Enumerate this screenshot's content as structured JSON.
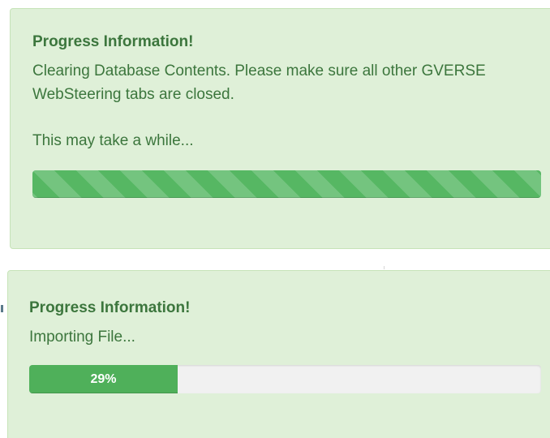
{
  "alerts": [
    {
      "title": "Progress Information!",
      "message": "Clearing Database Contents. Please make sure all other GVERSE WebSteering tabs are closed.",
      "note": "This may take a while...",
      "progress": {
        "kind": "striped-indeterminate",
        "fraction": 1.0
      }
    },
    {
      "title": "Progress Information!",
      "note": "Importing File...",
      "progress": {
        "kind": "percent",
        "fraction": 0.29,
        "label": "29%"
      }
    }
  ],
  "colors": {
    "alert_background": "#dff0d8",
    "alert_border": "#c6e3b8",
    "alert_text": "#3c763d",
    "progress_fill": "#4fb05a",
    "progress_track": "#f1f1f1"
  }
}
